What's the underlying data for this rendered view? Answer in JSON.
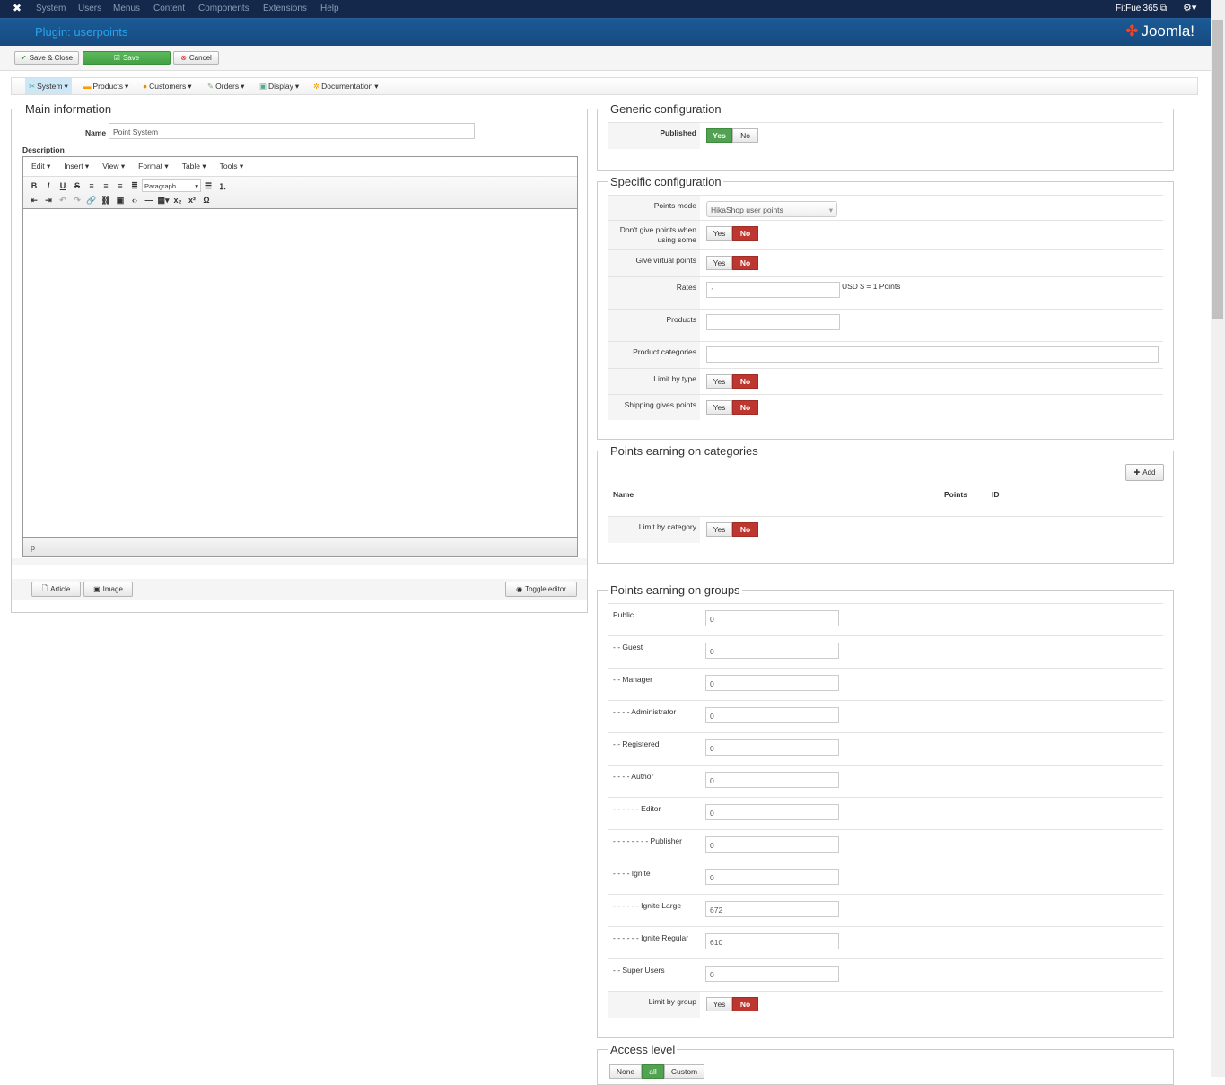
{
  "topbar": {
    "menu": [
      "System",
      "Users",
      "Menus",
      "Content",
      "Components",
      "Extensions",
      "Help"
    ],
    "user": "FitFuel365"
  },
  "header": {
    "title": "Plugin: userpoints",
    "logo": "Joomla!"
  },
  "toolbar": {
    "save_close": "Save & Close",
    "save": "Save",
    "cancel": "Cancel"
  },
  "menubar": [
    "System",
    "Products",
    "Customers",
    "Orders",
    "Display",
    "Documentation"
  ],
  "main": {
    "legend": "Main information",
    "name_label": "Name",
    "name_value": "Point System",
    "description_label": "Description",
    "editor_menu": [
      "Edit",
      "Insert",
      "View",
      "Format",
      "Table",
      "Tools"
    ],
    "format_select": "Paragraph",
    "path": "p",
    "article": "Article",
    "image": "Image",
    "toggle": "Toggle editor"
  },
  "generic": {
    "legend": "Generic configuration",
    "published_label": "Published",
    "yes": "Yes",
    "no": "No",
    "published": "Yes"
  },
  "specific": {
    "legend": "Specific configuration",
    "points_mode_label": "Points mode",
    "points_mode": "HikaShop user points",
    "dont_give_label": "Don't give points when using some",
    "virtual_label": "Give virtual points",
    "rates_label": "Rates",
    "rates_value": "1",
    "rates_suffix": "USD $ = 1 Points",
    "products_label": "Products",
    "categories_label": "Product categories",
    "limit_type_label": "Limit by type",
    "shipping_label": "Shipping gives points"
  },
  "categories": {
    "legend": "Points earning on categories",
    "add": "Add",
    "col_name": "Name",
    "col_points": "Points",
    "col_id": "ID",
    "limit_label": "Limit by category"
  },
  "groups": {
    "legend": "Points earning on groups",
    "limit_label": "Limit by group",
    "items": [
      {
        "label": "Public",
        "value": "0"
      },
      {
        "label": "- - Guest",
        "value": "0"
      },
      {
        "label": "- - Manager",
        "value": "0"
      },
      {
        "label": "- - - - Administrator",
        "value": "0"
      },
      {
        "label": "- - Registered",
        "value": "0"
      },
      {
        "label": "- - - - Author",
        "value": "0"
      },
      {
        "label": "- - - - - - Editor",
        "value": "0"
      },
      {
        "label": "- - - - - - - - Publisher",
        "value": "0"
      },
      {
        "label": "- - - - Ignite",
        "value": "0"
      },
      {
        "label": "- - - - - - Ignite Large",
        "value": "672"
      },
      {
        "label": "- - - - - - Ignite Regular",
        "value": "610"
      },
      {
        "label": "- - Super Users",
        "value": "0"
      }
    ]
  },
  "access": {
    "legend": "Access level",
    "options": [
      "None",
      "all",
      "Custom"
    ],
    "selected": "all"
  },
  "colors": {
    "green": "#51a351",
    "red": "#bd362f",
    "header": "#174a80"
  }
}
